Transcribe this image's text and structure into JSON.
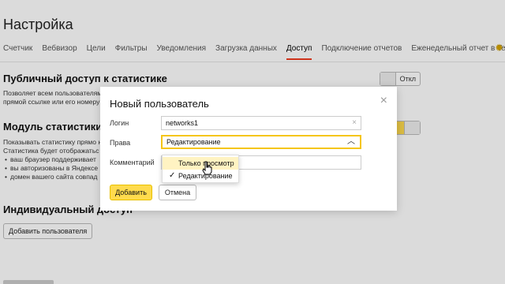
{
  "page": {
    "title": "Настройка",
    "tabs": [
      "Счетчик",
      "Вебвизор",
      "Цели",
      "Фильтры",
      "Уведомления",
      "Загрузка данных",
      "Доступ",
      "Подключение отчетов",
      "Еженедельный отчет в Telegram"
    ],
    "active_tab": "Доступ"
  },
  "public_access": {
    "heading": "Публичный доступ к статистике",
    "line1": "Позволяет всем пользователям",
    "line2": "прямой ссылке или его номеру",
    "toggle_label": "Откл"
  },
  "module": {
    "heading": "Модуль статистики на",
    "line1": "Показывать статистику прямо на",
    "line2": "Статистика будет отображатьс",
    "bullets": [
      "ваш браузер поддерживает",
      "вы авторизованы в Яндексе",
      "домен вашего сайта совпад"
    ],
    "toggle_label": "л"
  },
  "individual": {
    "heading": "Индивидуальный доступ",
    "add_button": "Добавить пользователя"
  },
  "modal": {
    "title": "Новый пользователь",
    "login_label": "Логин",
    "login_value": "networks1",
    "rights_label": "Права",
    "rights_value": "Редактирование",
    "comment_label": "Комментарий",
    "comment_value": "",
    "add_button": "Добавить",
    "cancel_button": "Отмена"
  },
  "dropdown": {
    "options": [
      "Только просмотр",
      "Редактирование"
    ],
    "selected": "Редактирование",
    "highlighted": "Только просмотр"
  },
  "colors": {
    "accent": "#ffdb4d",
    "active_tab_underline": "#f13c20"
  },
  "icons": {
    "close": "close-icon",
    "chevron": "chevron-up-icon",
    "check": "check-icon",
    "clear": "clear-icon",
    "telegram_tab": "sun-icon"
  }
}
